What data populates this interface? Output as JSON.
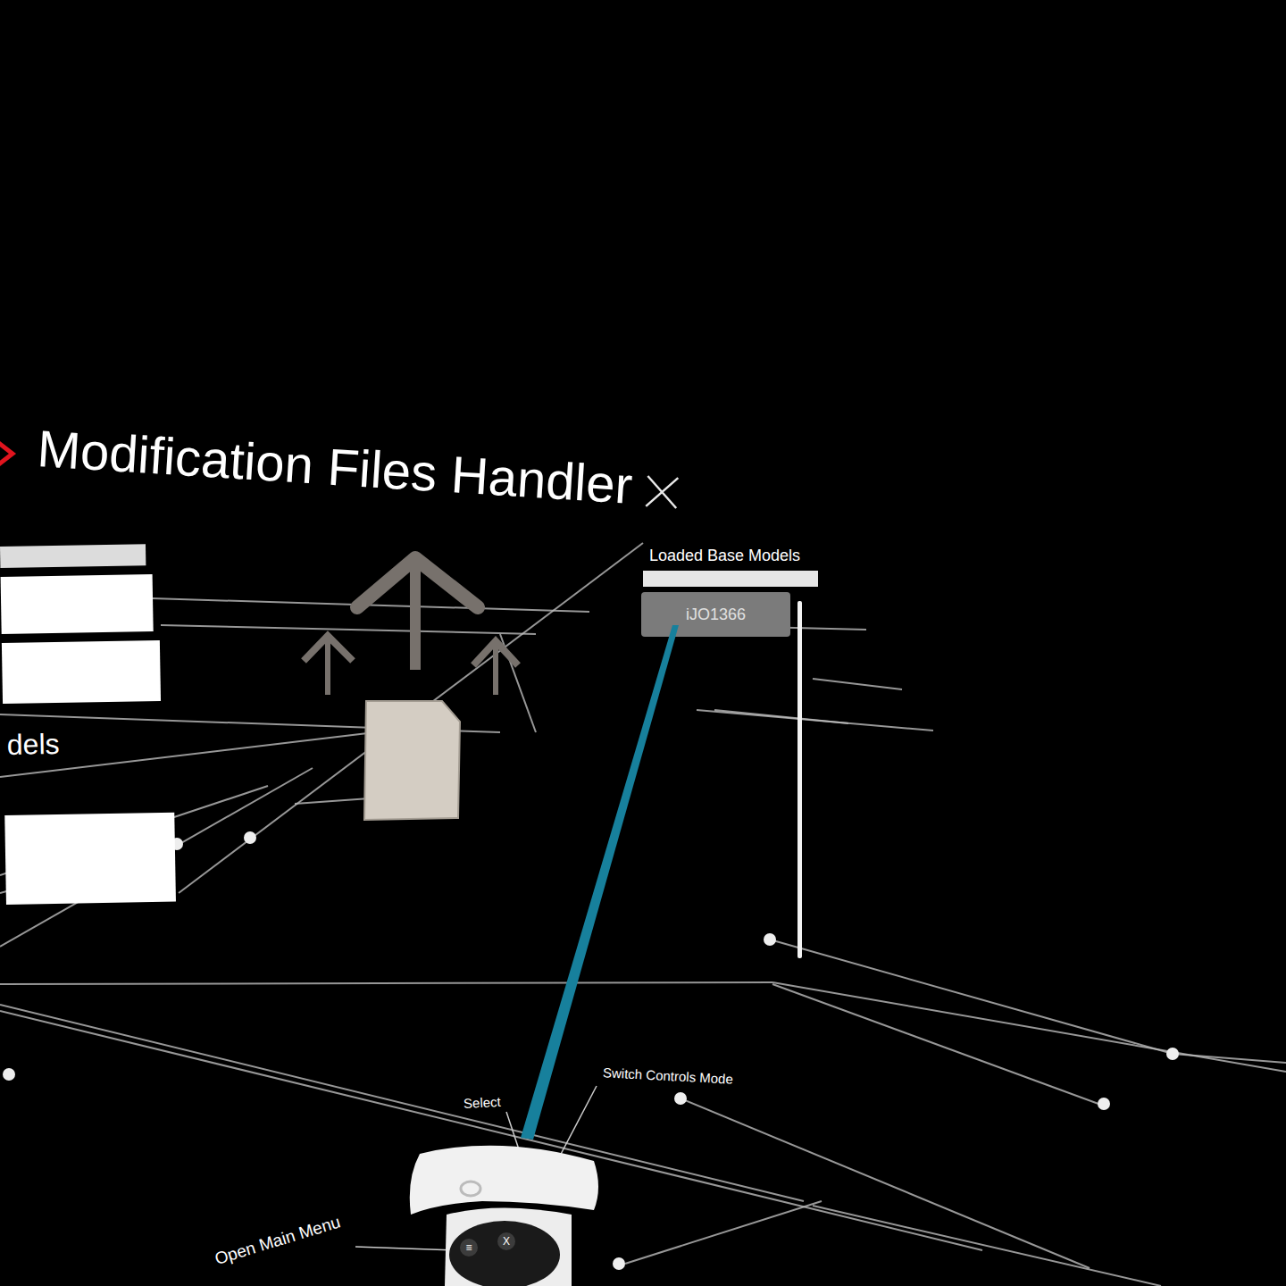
{
  "window": {
    "title": "Modification Files Handler"
  },
  "left_panel": {
    "label": "dels"
  },
  "base_models": {
    "title": "Loaded Base Models",
    "items": [
      {
        "label": "iJO1366",
        "selected": true
      }
    ]
  },
  "controller_hints": [
    {
      "label": "Select"
    },
    {
      "label": "Switch Controls Mode"
    },
    {
      "label": "Open Main Menu"
    }
  ],
  "controller_buttons": [
    "≡",
    "X"
  ]
}
